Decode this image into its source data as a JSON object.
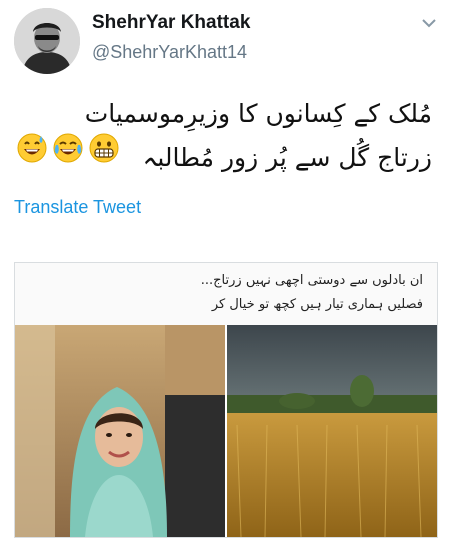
{
  "author": {
    "display_name": "ShehrYar Khattak",
    "handle": "@ShehrYarKhatt14"
  },
  "tweet": {
    "text_lines": [
      "مُلک کے کِسانوں کا وزیرِموسمیات",
      "زرتاج گُل سے پُر زور مُطالبہ"
    ],
    "emojis": [
      "grinning-sweat-emoji",
      "tears-of-joy-emoji",
      "grimacing-emoji"
    ]
  },
  "translate_label": "Translate Tweet",
  "media": {
    "caption_lines": [
      "ان بادلوں سے دوستی اچھی نہیں زرتاج...",
      "فصلیں ہماری تیار ہیں کچھ تو خیال کر"
    ]
  },
  "colors": {
    "link": "#1b95e0",
    "handle": "#657786",
    "name": "#14171a"
  }
}
